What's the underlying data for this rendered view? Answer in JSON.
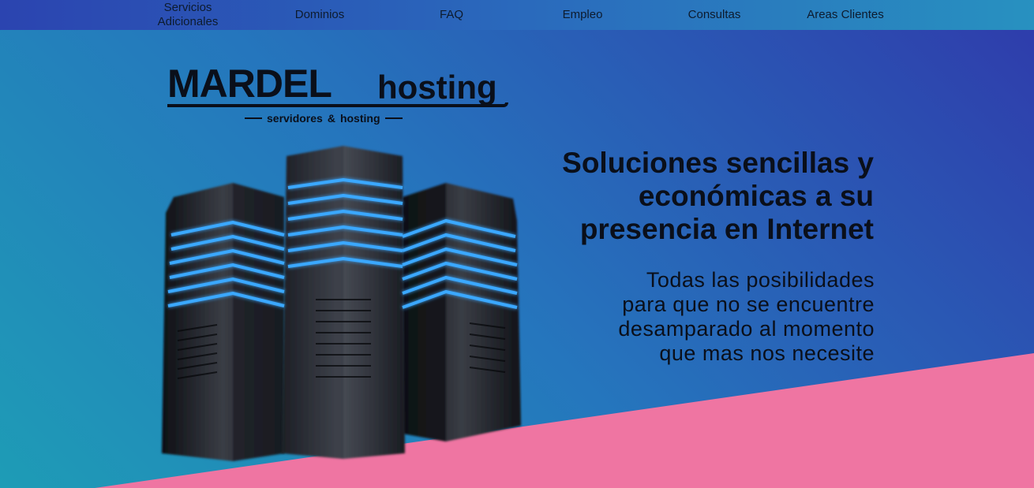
{
  "nav": {
    "items": [
      {
        "label_line1": "Servicios",
        "label_line2": "Adicionales"
      },
      {
        "label_line1": "Dominios",
        "label_line2": ""
      },
      {
        "label_line1": "FAQ",
        "label_line2": ""
      },
      {
        "label_line1": "Empleo",
        "label_line2": ""
      },
      {
        "label_line1": "Consultas",
        "label_line2": ""
      },
      {
        "label_line1": "Areas Clientes",
        "label_line2": ""
      }
    ]
  },
  "logo": {
    "main": "MARDEL",
    "sub": "hosting",
    "tag_left": "servidores",
    "tag_amp": "&",
    "tag_right": "hosting"
  },
  "hero": {
    "headline_1": "Soluciones sencillas y",
    "headline_2": "económicas a su",
    "headline_3": "presencia en Internet",
    "sub_1": "Todas las posibilidades",
    "sub_2": "para que no se encuentre",
    "sub_3": "desamparado al momento",
    "sub_4": "que mas nos necesite"
  },
  "colors": {
    "pink": "#ef75a2",
    "blue_dark": "#2f3bab",
    "teal": "#1e9cb6",
    "server_glow": "#3aa8ff"
  }
}
